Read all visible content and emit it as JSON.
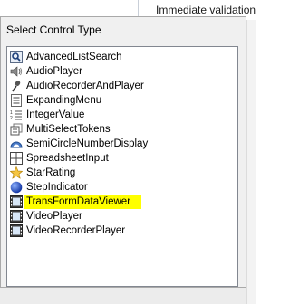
{
  "background": {
    "hint_text": "Immediate validation"
  },
  "popup": {
    "title": "Select Control Type",
    "items": [
      {
        "label": "AdvancedListSearch",
        "icon": "search-list-icon"
      },
      {
        "label": "AudioPlayer",
        "icon": "speaker-icon"
      },
      {
        "label": "AudioRecorderAndPlayer",
        "icon": "microphone-icon"
      },
      {
        "label": "ExpandingMenu",
        "icon": "menu-icon"
      },
      {
        "label": "IntegerValue",
        "icon": "number-list-icon"
      },
      {
        "label": "MultiSelectTokens",
        "icon": "tokens-icon"
      },
      {
        "label": "SemiCircleNumberDisplay",
        "icon": "gauge-icon"
      },
      {
        "label": "SpreadsheetInput",
        "icon": "grid-icon"
      },
      {
        "label": "StarRating",
        "icon": "star-icon"
      },
      {
        "label": "StepIndicator",
        "icon": "ball-icon"
      },
      {
        "label": "TransFormDataViewer",
        "icon": "film-icon"
      },
      {
        "label": "VideoPlayer",
        "icon": "film-icon"
      },
      {
        "label": "VideoRecorderPlayer",
        "icon": "film-icon"
      }
    ]
  },
  "highlight_color": "#ffff00"
}
